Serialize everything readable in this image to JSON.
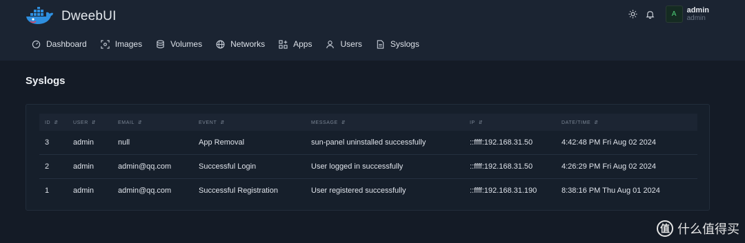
{
  "app": {
    "name": "DweebUI"
  },
  "user": {
    "name": "admin",
    "role": "admin",
    "avatar_letter": "A"
  },
  "icons": {
    "theme": "sun-icon",
    "notifications": "bell-icon"
  },
  "nav": [
    {
      "label": "Dashboard",
      "icon": "dashboard-icon"
    },
    {
      "label": "Images",
      "icon": "images-icon"
    },
    {
      "label": "Volumes",
      "icon": "database-icon"
    },
    {
      "label": "Networks",
      "icon": "globe-icon"
    },
    {
      "label": "Apps",
      "icon": "apps-icon"
    },
    {
      "label": "Users",
      "icon": "user-icon"
    },
    {
      "label": "Syslogs",
      "icon": "file-icon"
    }
  ],
  "page": {
    "title": "Syslogs"
  },
  "table": {
    "columns": [
      "ID",
      "USER",
      "EMAIL",
      "EVENT",
      "MESSAGE",
      "IP",
      "DATE/TIME"
    ],
    "rows": [
      [
        "3",
        "admin",
        "null",
        "App Removal",
        "sun-panel uninstalled successfully",
        "::ffff:192.168.31.50",
        "4:42:48 PM Fri Aug 02 2024"
      ],
      [
        "2",
        "admin",
        "admin@qq.com",
        "Successful Login",
        "User logged in successfully",
        "::ffff:192.168.31.50",
        "4:26:29 PM Fri Aug 02 2024"
      ],
      [
        "1",
        "admin",
        "admin@qq.com",
        "Successful Registration",
        "User registered successfully",
        "::ffff:192.168.31.190",
        "8:38:16 PM Thu Aug 01 2024"
      ]
    ]
  },
  "watermark": {
    "badge": "值",
    "text": "什么值得买"
  },
  "colors": {
    "background": "#141b26",
    "header": "#1b2432",
    "accent_green": "#4ed07a",
    "logo_blue": "#2e8fe0"
  }
}
